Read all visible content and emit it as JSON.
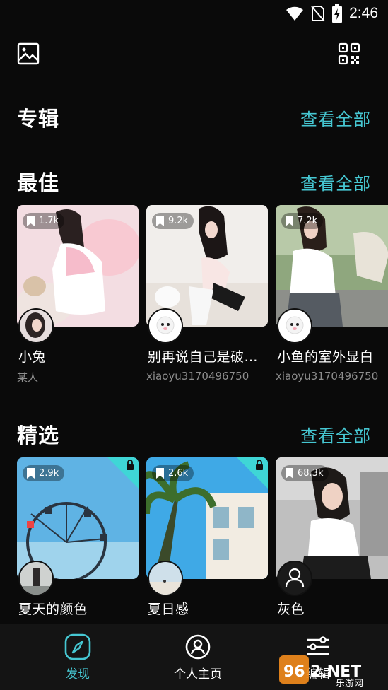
{
  "status": {
    "time": "2:46"
  },
  "top_bar": {
    "left_icon": "image-icon",
    "right_icon": "qr-code-icon"
  },
  "sections": {
    "album": {
      "title": "专辑",
      "see_all": "查看全部"
    },
    "best": {
      "title": "最佳",
      "see_all": "查看全部",
      "cards": [
        {
          "count": "1.7k",
          "title": "小兔",
          "author": "某人"
        },
        {
          "count": "9.2k",
          "title": "别再说自己是破…",
          "author": "xiaoyu3170496750"
        },
        {
          "count": "7.2k",
          "title": "小鱼的室外显白",
          "author": "xiaoyu3170496750"
        }
      ]
    },
    "featured": {
      "title": "精选",
      "see_all": "查看全部",
      "cards": [
        {
          "count": "2.9k",
          "title": "夏天的颜色",
          "locked": true
        },
        {
          "count": "2.6k",
          "title": "夏日感",
          "locked": true
        },
        {
          "count": "68.3k",
          "title": "灰色",
          "locked": false
        }
      ]
    }
  },
  "bottom_nav": {
    "items": [
      {
        "label": "发现",
        "icon": "compass-icon",
        "active": true
      },
      {
        "label": "个人主页",
        "icon": "user-circle-icon",
        "active": false
      },
      {
        "label": "编辑",
        "icon": "sliders-icon",
        "active": false
      }
    ]
  },
  "watermark": {
    "brand": "962.NET",
    "sub": "乐游网"
  },
  "colors": {
    "accent": "#46c7d2",
    "background": "#0a0a0a",
    "nav_bg": "#141414",
    "lock_triangle": "#3fd6d6"
  }
}
